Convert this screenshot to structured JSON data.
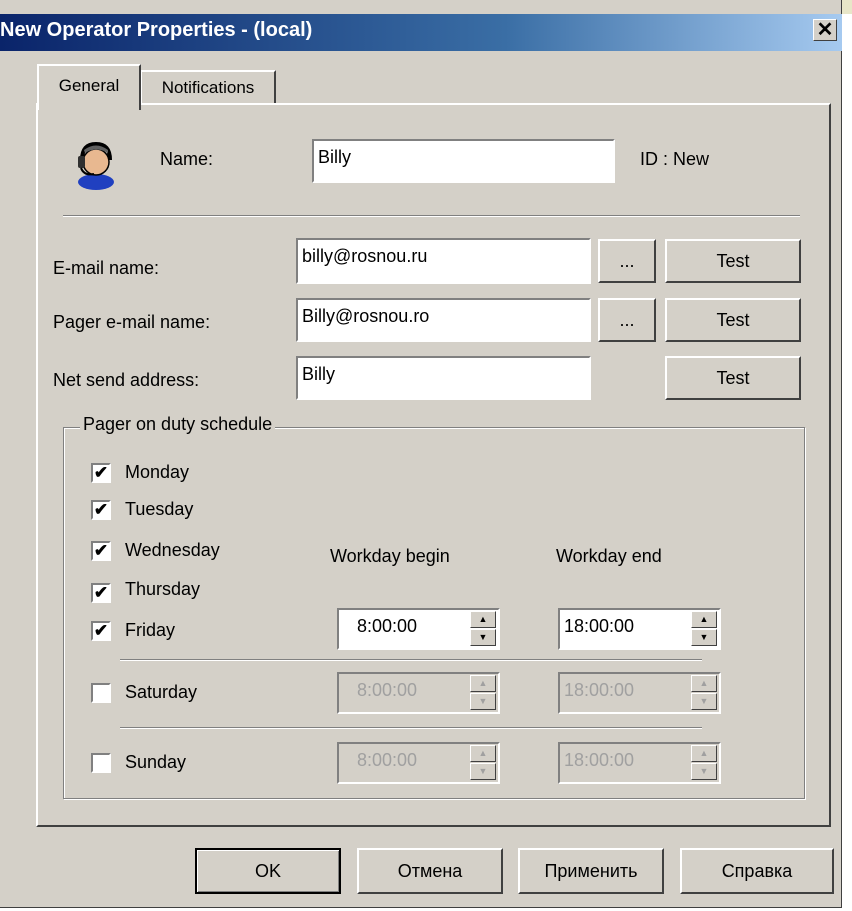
{
  "window": {
    "title": "New Operator Properties - (local)",
    "close_glyph": "✕"
  },
  "tabs": [
    {
      "label": "General",
      "active": true
    },
    {
      "label": "Notifications",
      "active": false
    }
  ],
  "general": {
    "name_label": "Name:",
    "name_value": "Billy",
    "id_text": "ID : New",
    "operator_icon": "operator-headset-icon",
    "email": {
      "label": "E-mail name:",
      "value": "billy@rosnou.ru",
      "browse": "...",
      "test": "Test"
    },
    "pager": {
      "label": "Pager e-mail name:",
      "value": "Billy@rosnou.ro",
      "browse": "...",
      "test": "Test"
    },
    "netsend": {
      "label": "Net send address:",
      "value": "Billy",
      "test": "Test"
    }
  },
  "schedule": {
    "legend": "Pager on duty schedule",
    "workday_begin_label": "Workday begin",
    "workday_end_label": "Workday end",
    "days": [
      {
        "label": "Monday",
        "checked": true
      },
      {
        "label": "Tuesday",
        "checked": true
      },
      {
        "label": "Wednesday",
        "checked": true
      },
      {
        "label": "Thursday",
        "checked": true
      },
      {
        "label": "Friday",
        "checked": true
      },
      {
        "label": "Saturday",
        "checked": false
      },
      {
        "label": "Sunday",
        "checked": false
      }
    ],
    "weekday_begin": "8:00:00",
    "weekday_end": "18:00:00",
    "saturday_begin": "8:00:00",
    "saturday_end": "18:00:00",
    "sunday_begin": "8:00:00",
    "sunday_end": "18:00:00",
    "check_glyph": "✔"
  },
  "buttons": {
    "ok": "OK",
    "cancel": "Отмена",
    "apply": "Применить",
    "help": "Справка"
  },
  "colors": {
    "dialog_bg": "#d4d0c8",
    "title_start": "#0a246a",
    "title_end": "#a6caf0"
  }
}
